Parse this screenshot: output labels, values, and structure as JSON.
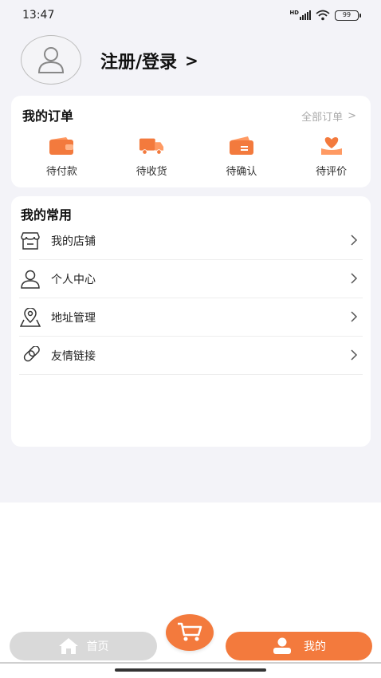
{
  "status_bar": {
    "time": "13:47",
    "battery": "99",
    "network": "HD"
  },
  "colors": {
    "accent": "#f37a3d",
    "background": "#f3f3f8",
    "card": "#ffffff",
    "tab_inactive": "#d9d9d9"
  },
  "profile": {
    "login_label": "注册/登录",
    "chevron": ">"
  },
  "orders": {
    "title": "我的订单",
    "all_label": "全部订单",
    "all_chevron": ">",
    "items": [
      {
        "label": "待付款",
        "icon": "wallet-icon"
      },
      {
        "label": "待收货",
        "icon": "truck-icon"
      },
      {
        "label": "待确认",
        "icon": "card-icon"
      },
      {
        "label": "待评价",
        "icon": "heart-hand-icon"
      }
    ]
  },
  "common": {
    "title": "我的常用",
    "items": [
      {
        "label": "我的店铺",
        "icon": "store-icon"
      },
      {
        "label": "个人中心",
        "icon": "person-icon"
      },
      {
        "label": "地址管理",
        "icon": "location-icon"
      },
      {
        "label": "友情链接",
        "icon": "link-icon"
      }
    ]
  },
  "tabbar": {
    "home_label": "首页",
    "mine_label": "我的",
    "cart_icon": "cart-icon"
  }
}
